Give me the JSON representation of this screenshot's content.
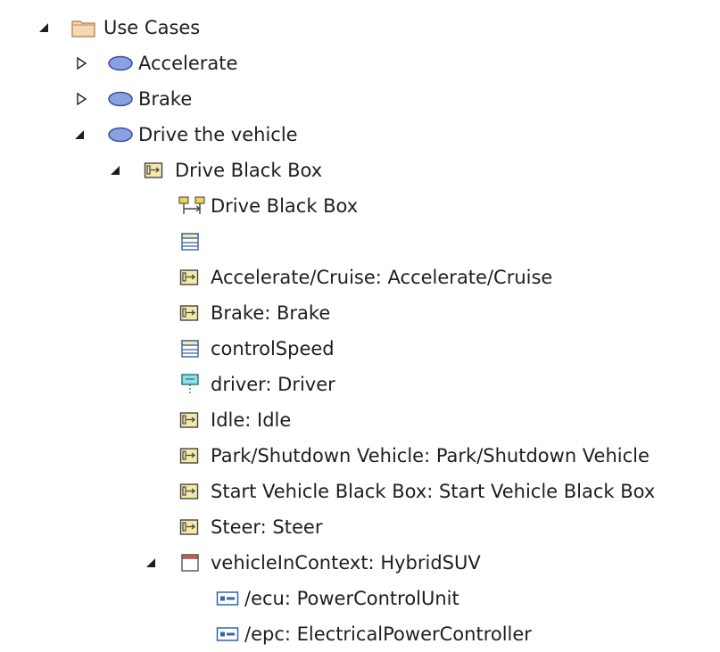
{
  "tree": {
    "use_cases": {
      "label": "Use Cases",
      "icon": "folder-icon",
      "expanded": true
    },
    "accelerate": {
      "label": "Accelerate",
      "icon": "use-case-icon",
      "expanded": false
    },
    "brake": {
      "label": "Brake",
      "icon": "use-case-icon",
      "expanded": false
    },
    "drive_the_vehicle": {
      "label": "Drive the vehicle",
      "icon": "use-case-icon",
      "expanded": true
    },
    "drive_black_box": {
      "label": "Drive Black Box",
      "icon": "activity-icon",
      "expanded": true
    },
    "drive_black_box_diagram": {
      "label": "Drive Black Box",
      "icon": "diagram-icon"
    },
    "unnamed_partition": {
      "label": "",
      "icon": "partition-icon"
    },
    "accelerate_cruise": {
      "label": "Accelerate/Cruise: Accelerate/Cruise",
      "icon": "action-icon"
    },
    "brake_action": {
      "label": "Brake: Brake",
      "icon": "action-icon"
    },
    "control_speed": {
      "label": "controlSpeed",
      "icon": "partition-icon"
    },
    "driver": {
      "label": "driver: Driver",
      "icon": "lifeline-icon"
    },
    "idle": {
      "label": "Idle: Idle",
      "icon": "action-icon"
    },
    "park_shutdown": {
      "label": "Park/Shutdown Vehicle: Park/Shutdown Vehicle",
      "icon": "action-icon"
    },
    "start_vehicle": {
      "label": "Start Vehicle Black Box: Start Vehicle Black Box",
      "icon": "action-icon"
    },
    "steer": {
      "label": "Steer: Steer",
      "icon": "action-icon"
    },
    "vehicle_in_context": {
      "label": "vehicleInContext: HybridSUV",
      "icon": "instance-icon",
      "expanded": true
    },
    "ecu": {
      "label": "/ecu: PowerControlUnit",
      "icon": "part-icon"
    },
    "epc": {
      "label": "/epc: ElectricalPowerController",
      "icon": "part-icon"
    }
  },
  "colors": {
    "folder_fill": "#f6d9b3",
    "folder_stroke": "#b98a5a",
    "use_case_fill": "#8aa0e0",
    "use_case_stroke": "#3a4fa0",
    "action_fill": "#f4e9a8",
    "accent_blue": "#3366aa"
  }
}
